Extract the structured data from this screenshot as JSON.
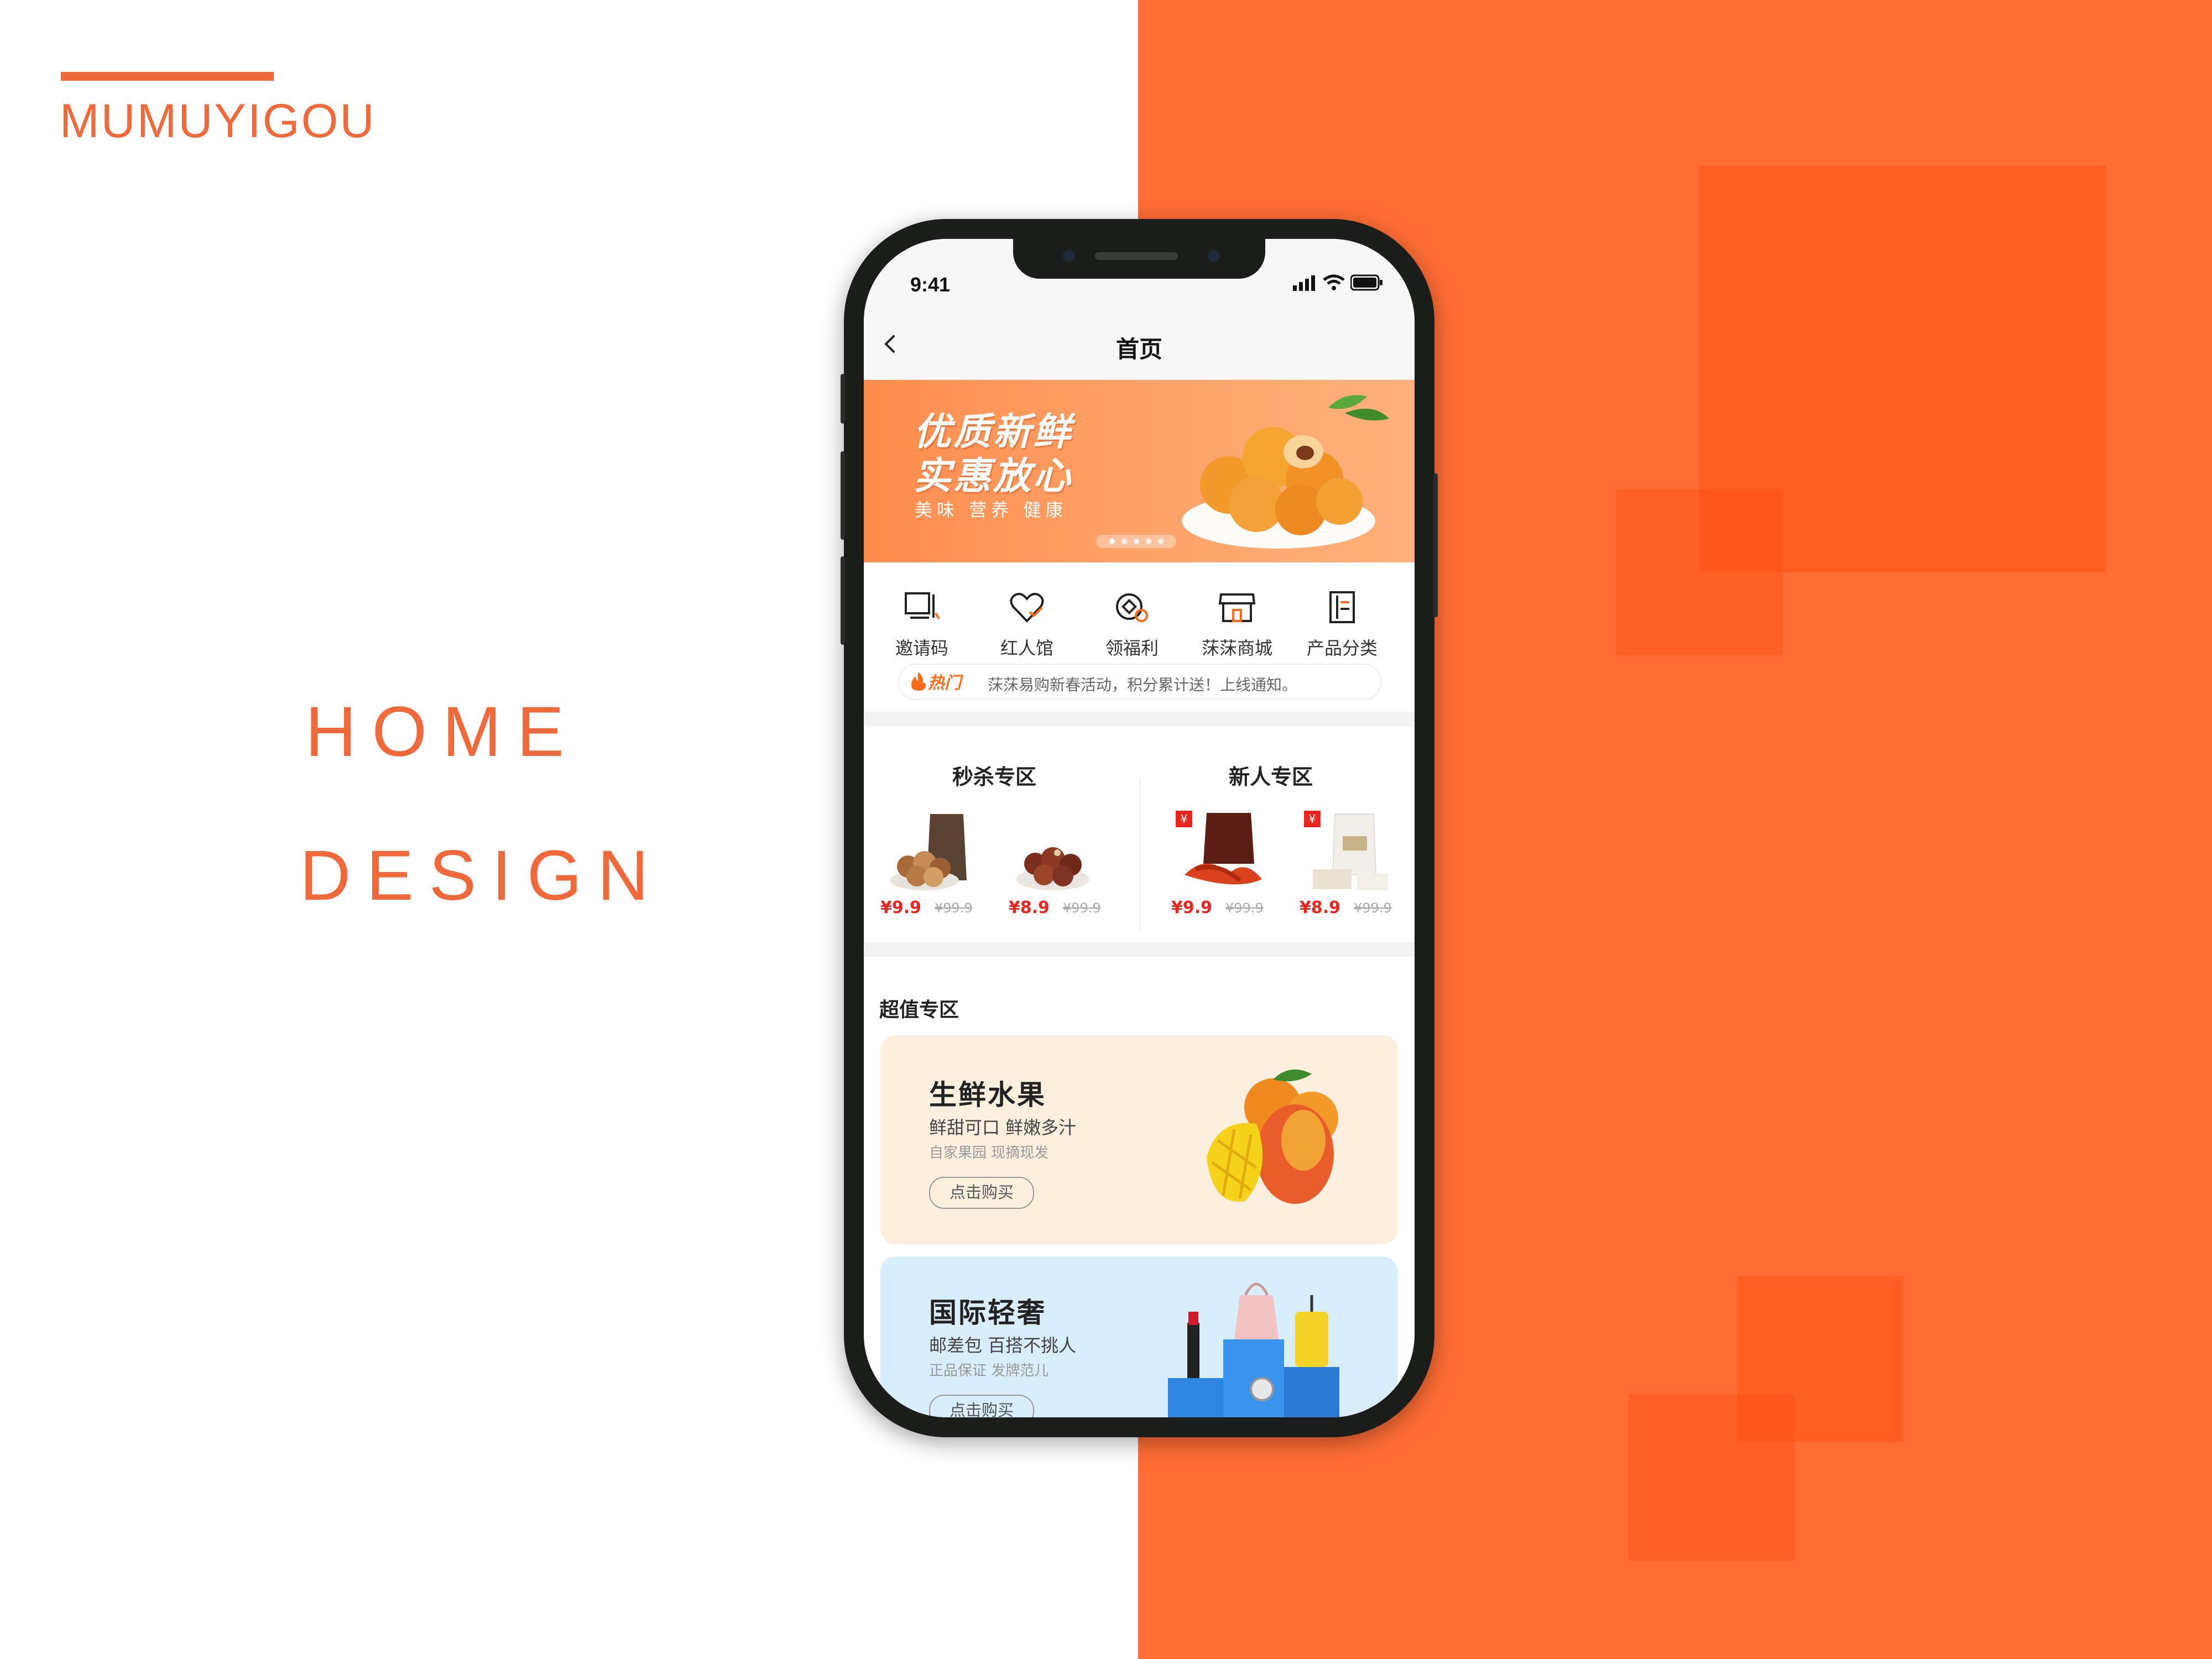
{
  "brand": {
    "name": "MUMUYIGOU",
    "accent": "#f0693a"
  },
  "headline": {
    "line1": "HOME",
    "line2": "DESIGN"
  },
  "background": {
    "right_color": "#ff6d35"
  },
  "phone": {
    "status": {
      "time": "9:41",
      "icons": [
        "signal-icon",
        "wifi-icon",
        "battery-icon"
      ]
    },
    "nav": {
      "title": "首页",
      "back_icon": "back-chevron-icon"
    },
    "banner": {
      "line1": "优质新鲜",
      "line2": "实惠放心",
      "subtitle": "美味 营养 健康",
      "slide_count": 5,
      "active_slide": 1
    },
    "categories": [
      {
        "label": "邀请码",
        "icon": "invite-code-icon"
      },
      {
        "label": "红人馆",
        "icon": "heart-icon"
      },
      {
        "label": "领福利",
        "icon": "coin-icon"
      },
      {
        "label": "莯莯商城",
        "icon": "store-icon"
      },
      {
        "label": "产品分类",
        "icon": "category-icon"
      }
    ],
    "notice": {
      "tag": "热门",
      "text": "莯莯易购新春活动，积分累计送！上线通知。"
    },
    "flash_sale": {
      "title": "秒杀专区",
      "items": [
        {
          "price": "¥9.9",
          "original": "¥99.9"
        },
        {
          "price": "¥8.9",
          "original": "¥99.9"
        }
      ]
    },
    "new_user": {
      "title": "新人专区",
      "items": [
        {
          "price": "¥9.9",
          "original": "¥99.9"
        },
        {
          "price": "¥8.9",
          "original": "¥99.9"
        }
      ]
    },
    "value_zone": {
      "title": "超值专区",
      "cards": [
        {
          "title": "生鲜水果",
          "sub": "鲜甜可口 鲜嫩多汁",
          "sub2": "自家果园 现摘现发",
          "button": "点击购买",
          "bg": "#fcefdd"
        },
        {
          "title": "国际轻奢",
          "sub": "邮差包 百搭不挑人",
          "sub2": "正品保证 发牌范儿",
          "button": "点击购买",
          "bg": "#d9eefc"
        }
      ]
    }
  }
}
